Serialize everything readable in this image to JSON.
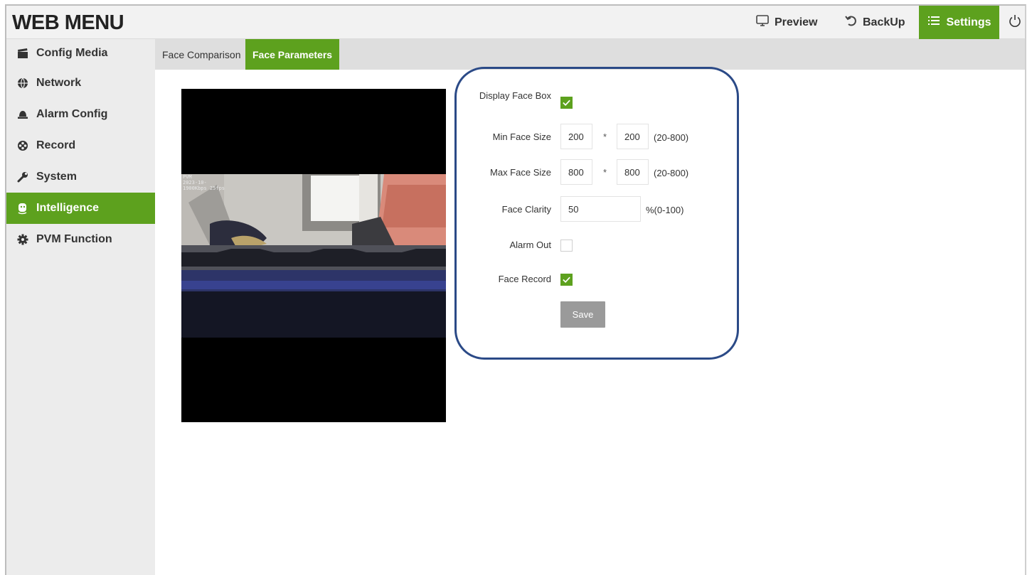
{
  "header": {
    "brand": "WEB MENU",
    "preview_label": "Preview",
    "backup_label": "BackUp",
    "settings_label": "Settings"
  },
  "sidebar": {
    "items": [
      {
        "label": "Config Media",
        "icon": "clapperboard-icon"
      },
      {
        "label": "Network",
        "icon": "globe-icon"
      },
      {
        "label": "Alarm Config",
        "icon": "alarm-bell-icon"
      },
      {
        "label": "Record",
        "icon": "film-reel-icon"
      },
      {
        "label": "System",
        "icon": "wrench-icon"
      },
      {
        "label": "Intelligence",
        "icon": "face-icon",
        "active": true
      },
      {
        "label": "PVM Function",
        "icon": "gear-icon"
      }
    ]
  },
  "tabs": [
    {
      "label": "Face Comparison",
      "active": false
    },
    {
      "label": "Face Parameters",
      "active": true
    }
  ],
  "video": {
    "osd_lines": [
      "PVM",
      "2023-10-",
      "1900Kbps 25fps"
    ]
  },
  "form": {
    "display_face_box": {
      "label": "Display Face Box",
      "checked": true
    },
    "min_face_size": {
      "label": "Min Face Size",
      "width": "200",
      "height": "200",
      "sep": "*",
      "range": "(20-800)"
    },
    "max_face_size": {
      "label": "Max Face Size",
      "width": "800",
      "height": "800",
      "sep": "*",
      "range": "(20-800)"
    },
    "face_clarity": {
      "label": "Face Clarity",
      "value": "50",
      "range": "%(0-100)"
    },
    "alarm_out": {
      "label": "Alarm Out",
      "checked": false
    },
    "face_record": {
      "label": "Face Record",
      "checked": true
    },
    "save_label": "Save"
  },
  "colors": {
    "accent": "#5da11e",
    "highlight_outline": "#2b4a87",
    "save_disabled": "#9a9a9a"
  }
}
